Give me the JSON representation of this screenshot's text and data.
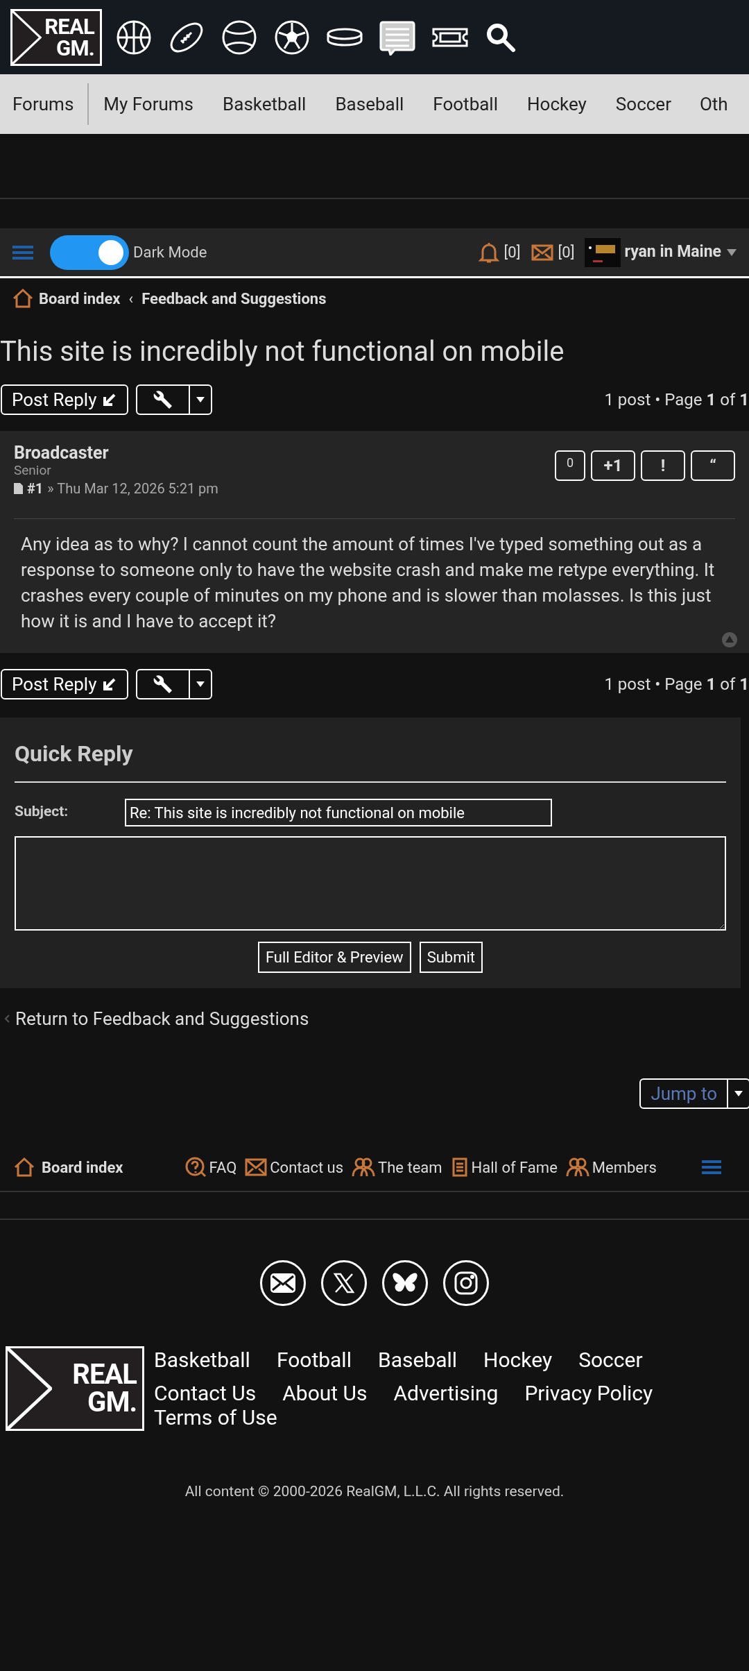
{
  "header": {
    "logo": [
      "REAL",
      "GM."
    ]
  },
  "nav": [
    "Forums",
    "My Forums",
    "Basketball",
    "Baseball",
    "Football",
    "Hockey",
    "Soccer",
    "Oth"
  ],
  "user_bar": {
    "dark_mode": {
      "label": "Dark Mode",
      "on": true
    },
    "notifications": "[0]",
    "messages": "[0]",
    "username": "ryan in Maine"
  },
  "breadcrumbs": [
    "Board index",
    "‹",
    "Feedback and Suggestions"
  ],
  "topic_title": "This site is incredibly not functional on mobile",
  "actions_top": {
    "post_reply": "Post Reply",
    "pagination": "1 post • Page **1** of **1**"
  },
  "post": {
    "author": "Broadcaster",
    "rank": "Senior",
    "number": "#1",
    "date": "» Thu Mar 12, 2026 5:21 pm",
    "buttons": [
      "0",
      "+1",
      "!",
      "“"
    ],
    "body": "Any idea as to why? I cannot count the amount of times I've typed something out as a response to someone only to have the website crash and make me retype everything. It crashes every couple of minutes on my phone and is slower than molasses. Is this just how it is and I have to accept it?"
  },
  "actions_bottom": {
    "post_reply": "Post Reply",
    "pagination": "1 post • Page **1** of **1**"
  },
  "quick_reply": {
    "title": "Quick Reply",
    "subject_label": "Subject:",
    "subject_value": "Re: This site is incredibly not functional on mobile",
    "buttons": [
      "Full Editor & Preview",
      "Submit"
    ]
  },
  "return_link": "Return to Feedback and Suggestions",
  "jump_to": "Jump to",
  "footer_nav": [
    {
      "kind": "home",
      "label": "Board index"
    },
    {
      "kind": "faq",
      "label": "FAQ"
    },
    {
      "kind": "mail",
      "label": "Contact us"
    },
    {
      "kind": "team",
      "label": "The team"
    },
    {
      "kind": "scroll",
      "label": "Hall of Fame"
    },
    {
      "kind": "team",
      "label": "Members"
    }
  ],
  "footer_logo": [
    "REAL",
    "GM."
  ],
  "footer_links": [
    [
      "Basketball",
      "Football",
      "Baseball",
      "Hockey",
      "Soccer"
    ],
    [
      "Contact Us",
      "About Us",
      "Advertising",
      "Privacy Policy"
    ],
    [
      "Terms of Use"
    ]
  ],
  "copyright": "All content © 2000-2026 RealGM, L.L.C. All rights reserved."
}
